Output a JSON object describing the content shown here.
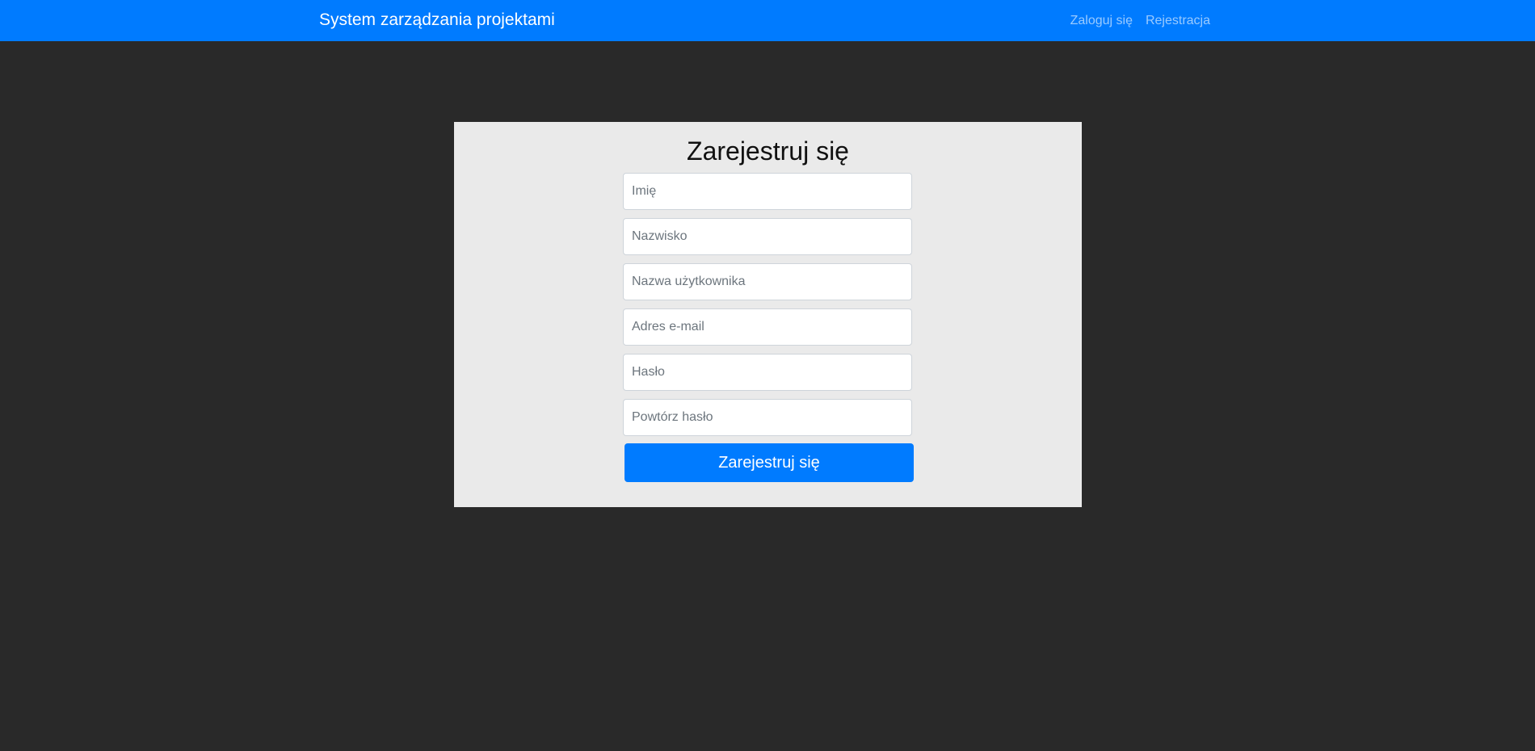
{
  "navbar": {
    "brand": "System zarządzania projektami",
    "links": [
      {
        "label": "Zaloguj się"
      },
      {
        "label": "Rejestracja"
      }
    ],
    "colors": {
      "background": "#007bff",
      "text": "#ffffff"
    }
  },
  "form": {
    "title": "Zarejestruj się",
    "fields": [
      {
        "placeholder": "Imię",
        "value": ""
      },
      {
        "placeholder": "Nazwisko",
        "value": ""
      },
      {
        "placeholder": "Nazwa użytkownika",
        "value": ""
      },
      {
        "placeholder": "Adres e-mail",
        "value": ""
      },
      {
        "placeholder": "Hasło",
        "value": ""
      },
      {
        "placeholder": "Powtórz hasło",
        "value": ""
      }
    ],
    "submit_label": "Zarejestruj się",
    "colors": {
      "card": "#eaeaea",
      "button": "#007bff",
      "page": "#292929"
    }
  }
}
